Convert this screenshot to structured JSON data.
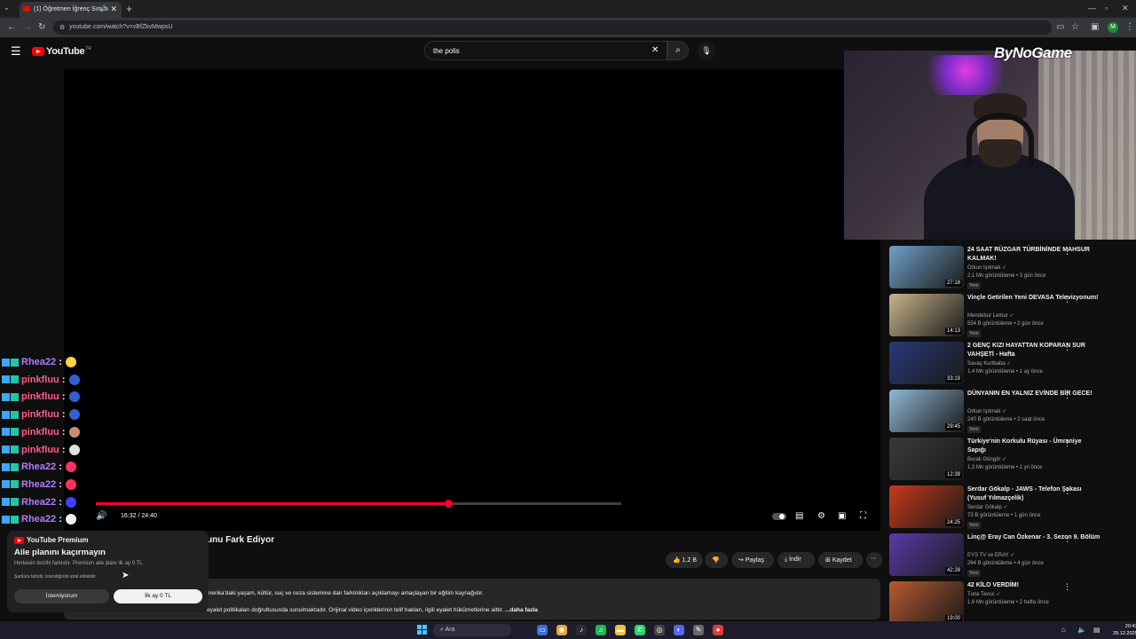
{
  "browser": {
    "tab_title": "(1) Öğretmen İğrenç Sırrını",
    "tab_close": "✕",
    "new_tab": "+",
    "url": "youtube.com/watch?v=vBfZkvMwpsU",
    "profile_initial": "M"
  },
  "youtube": {
    "logo_text": "YouTube",
    "logo_region": "TR",
    "search_value": "the polis",
    "search_clear": "✕"
  },
  "player": {
    "current_time": "16:32",
    "duration": "24:40",
    "time_display": "16:32 / 24:40",
    "progress_fraction": 0.67
  },
  "webcam": {
    "overlay_logo": "ByNoGame"
  },
  "video": {
    "title_visible": "unu Fark Ediyor",
    "likes": "1,2 B",
    "share_label": "Paylaş",
    "download_label": "İndir",
    "save_label": "Kaydet",
    "description_line1": "merika'daki yaşam, kültür, suç ve ceza sistemine dair farklılıkları açıklamayı amaçlayan bir eğitim kaynağıdır.",
    "description_line2": "eyalet politikaları doğrultusunda sunulmaktadır. Orijinal video içeriklerinin telif hakları, ilgili eyalet hükümetlerine aittir.",
    "description_more": "...daha fazla"
  },
  "premium_promo": {
    "logo_text": "YouTube Premium",
    "heading": "Aile planını kaçırmayın",
    "description": "Herkesin tercihi farklıdır. Premium aile planı ilk ay 0 TL",
    "note": "Şartlara tabidir, istendiğinde iptal edilebilir",
    "decline_label": "İstemiyorum",
    "accept_label": "İlk ay 0 TL"
  },
  "chat": [
    {
      "user": "Rhea22",
      "color": "#b07cff",
      "emote_color": "#ffd23f"
    },
    {
      "user": "pinkfluu",
      "color": "#ff5c8a",
      "emote_color": "#3060d0"
    },
    {
      "user": "pinkfluu",
      "color": "#ff5c8a",
      "emote_color": "#3060d0"
    },
    {
      "user": "pinkfluu",
      "color": "#ff5c8a",
      "emote_color": "#3060d0"
    },
    {
      "user": "pinkfluu",
      "color": "#ff5c8a",
      "emote_color": "#c89070"
    },
    {
      "user": "pinkfluu",
      "color": "#ff5c8a",
      "emote_color": "#e0e0e0"
    },
    {
      "user": "Rhea22",
      "color": "#b07cff",
      "emote_color": "#ff3060"
    },
    {
      "user": "Rhea22",
      "color": "#b07cff",
      "emote_color": "#ff3060"
    },
    {
      "user": "Rhea22",
      "color": "#b07cff",
      "emote_color": "#4040ff"
    },
    {
      "user": "Rhea22",
      "color": "#b07cff",
      "emote_color": "#f0f0f0"
    }
  ],
  "recommendations": [
    {
      "title": "24 SAAT RÜZGAR TÜRBİNİNDE MAHSUR KALMAK!",
      "channel": "Orkun Işıtmak",
      "meta": "2,1 Mn görüntüleme • 3 gün önce",
      "badge": "Yeni",
      "duration": "27:18",
      "thumb": "#6fa0c8"
    },
    {
      "title": "Vinçle Getirilen Yeni DEVASA Televizyonum!",
      "channel": "Mendebur Lemur",
      "meta": "554 B görüntüleme • 2 gün önce",
      "badge": "Yeni",
      "duration": "14:13",
      "thumb": "#c9b48a"
    },
    {
      "title": "2 GENÇ KIZI HAYATTAN KOPARAN SUR VAHŞETİ - Hafta",
      "channel": "Savaş Kurtbaba",
      "meta": "1,4 Mn görüntüleme • 1 ay önce",
      "badge": "",
      "duration": "33:19",
      "thumb": "#283a78"
    },
    {
      "title": "DÜNYANIN EN YALNIZ EVİNDE BİR GECE!",
      "channel": "Orkun Işıtmak",
      "meta": "240 B görüntüleme • 2 saat önce",
      "badge": "Yeni",
      "duration": "29:45",
      "thumb": "#8fb8d8"
    },
    {
      "title": "Türkiye'nin Korkulu Rüyası - Ümraniye Sapığı",
      "channel": "Burak Güngör",
      "meta": "1,3 Mn görüntüleme • 1 yıl önce",
      "badge": "",
      "duration": "12:39",
      "thumb": "#3a3a3a"
    },
    {
      "title": "Serdar Gökalp - JAWS - Telefon Şakası (Yusuf Yılmazçelik)",
      "channel": "Serdar Gökalp",
      "meta": "73 B görüntüleme • 1 gün önce",
      "badge": "Yeni",
      "duration": "24:25",
      "thumb": "#c83a1a"
    },
    {
      "title": "Linç@ Eray Can Özkenar - 3. Sezon 9. Bölüm",
      "channel": "EYS TV ve ERAY",
      "meta": "264 B görüntüleme • 4 gün önce",
      "badge": "Yeni",
      "duration": "42:28",
      "thumb": "#5a3aa8"
    },
    {
      "title": "42 KİLO VERDİM!",
      "channel": "Tuna Tavus",
      "meta": "1,6 Mn görüntüleme • 2 hafta önce",
      "badge": "",
      "duration": "19:00",
      "thumb": "#b85a30"
    }
  ],
  "taskbar": {
    "search_label": "Ara",
    "time": "20:43",
    "date": "29.12.2025"
  }
}
